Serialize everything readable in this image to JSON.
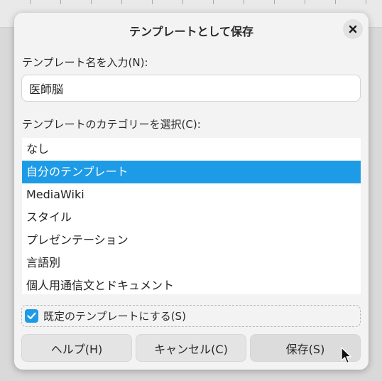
{
  "dialog": {
    "title": "テンプレートとして保存",
    "close_symbol": "✕"
  },
  "name_field": {
    "label": "テンプレート名を入力(N):",
    "value": "医師脳"
  },
  "category": {
    "label": "テンプレートのカテゴリーを選択(C):",
    "items": [
      {
        "label": "なし",
        "selected": false
      },
      {
        "label": "自分のテンプレート",
        "selected": true
      },
      {
        "label": "MediaWiki",
        "selected": false
      },
      {
        "label": "スタイル",
        "selected": false
      },
      {
        "label": "プレゼンテーション",
        "selected": false
      },
      {
        "label": "言語別",
        "selected": false
      },
      {
        "label": "個人用通信文とドキュメント",
        "selected": false
      }
    ]
  },
  "default_checkbox": {
    "label": "既定のテンプレートにする(S)",
    "checked": true
  },
  "buttons": {
    "help": "ヘルプ(H)",
    "cancel": "キャンセル(C)",
    "save": "保存(S)"
  },
  "colors": {
    "accent": "#1e9be6",
    "dialog_bg": "#f3f3f3"
  },
  "icons": {
    "close": "close-icon",
    "check": "checkmark-icon",
    "cursor": "mouse-pointer-icon"
  }
}
